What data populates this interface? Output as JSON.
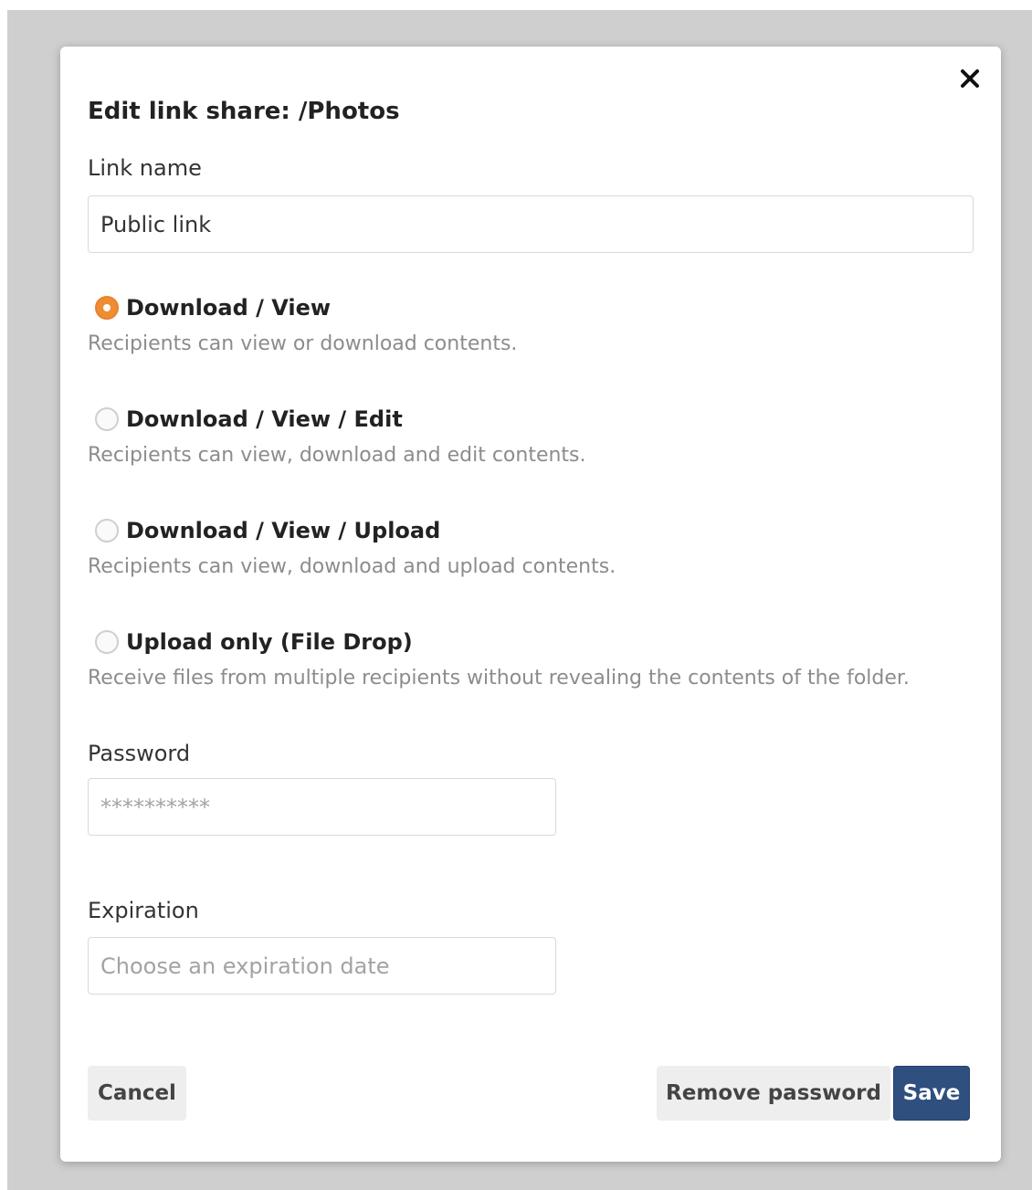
{
  "dialog": {
    "title": "Edit link share: /Photos",
    "close_icon": "close-icon"
  },
  "link_name": {
    "label": "Link name",
    "value": "Public link"
  },
  "permissions": {
    "selected": "download_view",
    "options": [
      {
        "id": "download_view",
        "label": "Download / View",
        "description": "Recipients can view or download contents.",
        "checked": true
      },
      {
        "id": "download_view_edit",
        "label": "Download / View / Edit",
        "description": "Recipients can view, download and edit contents.",
        "checked": false
      },
      {
        "id": "download_view_upload",
        "label": "Download / View / Upload",
        "description": "Recipients can view, download and upload contents.",
        "checked": false
      },
      {
        "id": "upload_only",
        "label": "Upload only (File Drop)",
        "description": "Receive files from multiple recipients without revealing the contents of the folder.",
        "checked": false
      }
    ]
  },
  "password": {
    "label": "Password",
    "placeholder": "**********",
    "value": ""
  },
  "expiration": {
    "label": "Expiration",
    "placeholder": "Choose an expiration date",
    "value": ""
  },
  "buttons": {
    "cancel": "Cancel",
    "remove_password": "Remove password",
    "save": "Save"
  },
  "colors": {
    "accent_radio": "#f08d33",
    "primary_button": "#2f4f7f",
    "secondary_button": "#eeeeee",
    "backdrop": "#cfcfcf"
  }
}
